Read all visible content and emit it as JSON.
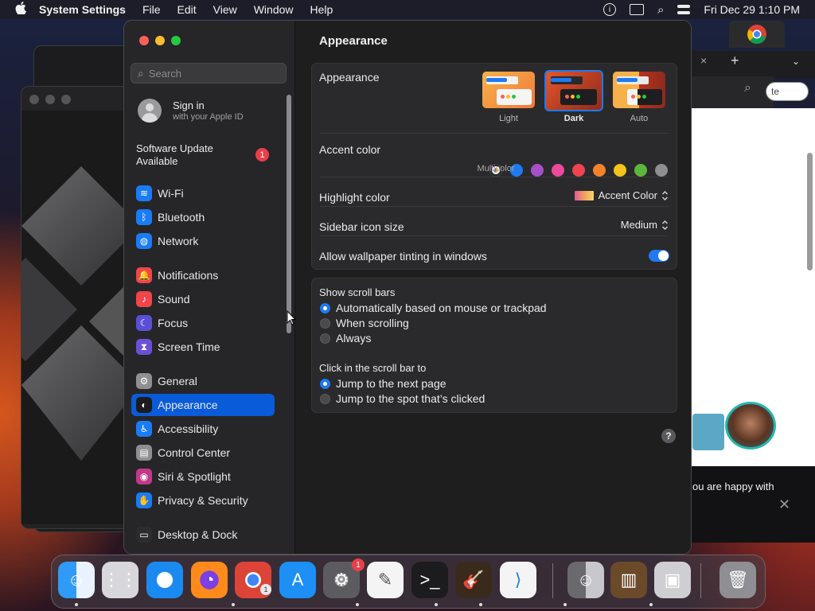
{
  "menubar": {
    "app_name": "System Settings",
    "menus": [
      "File",
      "Edit",
      "View",
      "Window",
      "Help"
    ],
    "datetime": "Fri Dec 29  1:10 PM"
  },
  "sidebar": {
    "search_placeholder": "Search",
    "signin_title": "Sign in",
    "signin_subtitle": "with your Apple ID",
    "update_label": "Software Update Available",
    "update_badge": "1",
    "items": [
      {
        "label": "Wi-Fi",
        "icon": "wifi-icon",
        "color": "#1a7cf5"
      },
      {
        "label": "Bluetooth",
        "icon": "bluetooth-icon",
        "color": "#1a7cf5"
      },
      {
        "label": "Network",
        "icon": "globe-icon",
        "color": "#1a7cf5"
      },
      {
        "label": "Notifications",
        "icon": "bell-icon",
        "color": "#f0454a"
      },
      {
        "label": "Sound",
        "icon": "speaker-icon",
        "color": "#f0454a"
      },
      {
        "label": "Focus",
        "icon": "moon-icon",
        "color": "#5a4fd6"
      },
      {
        "label": "Screen Time",
        "icon": "hourglass-icon",
        "color": "#6b4fd6"
      },
      {
        "label": "General",
        "icon": "gear-icon",
        "color": "#8e8e93"
      },
      {
        "label": "Appearance",
        "icon": "appearance-icon",
        "color": "#1c1c1e"
      },
      {
        "label": "Accessibility",
        "icon": "accessibility-icon",
        "color": "#1a7cf5"
      },
      {
        "label": "Control Center",
        "icon": "control-center-icon",
        "color": "#8e8e93"
      },
      {
        "label": "Siri & Spotlight",
        "icon": "siri-icon",
        "color": "#c0398a"
      },
      {
        "label": "Privacy & Security",
        "icon": "hand-icon",
        "color": "#1a7cf5"
      },
      {
        "label": "Desktop & Dock",
        "icon": "dock-icon",
        "color": "#2c2c2e"
      }
    ]
  },
  "main": {
    "title": "Appearance",
    "appearance_label": "Appearance",
    "appearance_options": [
      "Light",
      "Dark",
      "Auto"
    ],
    "appearance_selected": "Dark",
    "accent_label": "Accent color",
    "accent_colors": [
      "multicolor",
      "#1f7af0",
      "#a550c8",
      "#ec4a9a",
      "#ef4450",
      "#f5822a",
      "#f6c31c",
      "#5db63c",
      "#8e8e93"
    ],
    "accent_selected_name": "Multicolor",
    "highlight_label": "Highlight color",
    "highlight_value": "Accent Color",
    "icon_size_label": "Sidebar icon size",
    "icon_size_value": "Medium",
    "tinting_label": "Allow wallpaper tinting in windows",
    "tinting_on": true,
    "scroll_bars_label": "Show scroll bars",
    "scroll_options": [
      "Automatically based on mouse or trackpad",
      "When scrolling",
      "Always"
    ],
    "scroll_selected": 0,
    "click_label": "Click in the scroll bar to",
    "click_options": [
      "Jump to the next page",
      "Jump to the spot that’s clicked"
    ],
    "click_selected": 0,
    "help": "?"
  },
  "background": {
    "chrome_partial_text": "te",
    "banner_text": "ou are happy with"
  },
  "dock": {
    "apps": [
      "finder-icon",
      "launchpad-icon",
      "safari-icon",
      "firefox-icon",
      "chrome-icon",
      "app-store-icon",
      "system-settings-icon",
      "textedit-icon",
      "terminal-icon",
      "garageband-icon",
      "vscode-icon",
      "finder-alt-icon",
      "calibre-icon",
      "preview-icon",
      "trash-icon"
    ],
    "settings_badge": "1",
    "chrome_badge": "1"
  }
}
